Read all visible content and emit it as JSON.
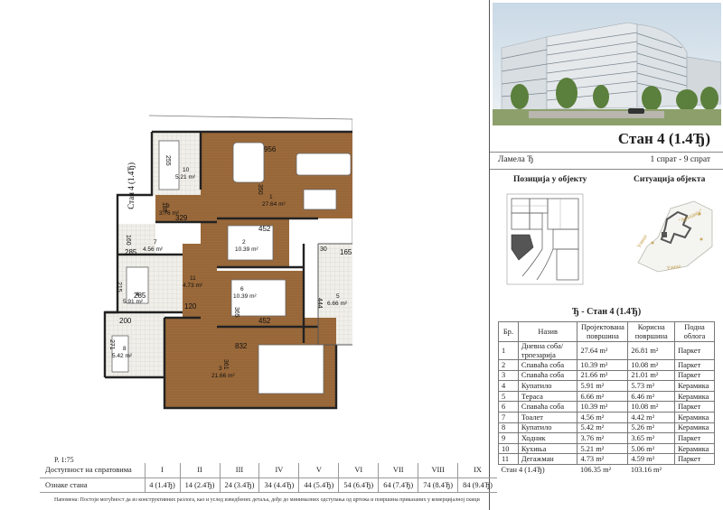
{
  "apartment": {
    "title": "Стан 4 (1.4Ђ)",
    "lamela": "Ламела Ђ",
    "floors_range": "1 спрат - 9 спрат"
  },
  "maps": {
    "position_label": "Позиција у објекту",
    "situation_label": "Ситуација објекта",
    "street_top": "Улица",
    "street_bottom": "Улица",
    "complex_label": "\"Аркадија\""
  },
  "area_table": {
    "title": "Ђ - Стан 4 (1.4Ђ)",
    "headers": {
      "no": "Бр.",
      "name": "Назив",
      "designed": "Пројектована површина",
      "usable": "Корисна површина",
      "floor": "Подна облога"
    },
    "rows": [
      {
        "no": "1",
        "name": "Дневна соба/трпезарија",
        "designed": "27.64 m²",
        "usable": "26.81 m²",
        "floor": "Паркет"
      },
      {
        "no": "2",
        "name": "Спаваћа соба",
        "designed": "10.39 m²",
        "usable": "10.08 m²",
        "floor": "Паркет"
      },
      {
        "no": "3",
        "name": "Спаваћа соба",
        "designed": "21.66 m²",
        "usable": "21.01 m²",
        "floor": "Паркет"
      },
      {
        "no": "4",
        "name": "Купатило",
        "designed": "5.91 m²",
        "usable": "5.73 m²",
        "floor": "Керамика"
      },
      {
        "no": "5",
        "name": "Тераса",
        "designed": "6.66 m²",
        "usable": "6.46 m²",
        "floor": "Керамика"
      },
      {
        "no": "6",
        "name": "Спаваћа соба",
        "designed": "10.39 m²",
        "usable": "10.08 m²",
        "floor": "Паркет"
      },
      {
        "no": "7",
        "name": "Тоалет",
        "designed": "4.56 m²",
        "usable": "4.42 m²",
        "floor": "Керамика"
      },
      {
        "no": "8",
        "name": "Купатило",
        "designed": "5.42 m²",
        "usable": "5.26 m²",
        "floor": "Керамика"
      },
      {
        "no": "9",
        "name": "Ходник",
        "designed": "3.76 m²",
        "usable": "3.65 m²",
        "floor": "Паркет"
      },
      {
        "no": "10",
        "name": "Кухиња",
        "designed": "5.21 m²",
        "usable": "5.06 m²",
        "floor": "Керамика"
      },
      {
        "no": "11",
        "name": "Дегажман",
        "designed": "4.73 m²",
        "usable": "4.59 m²",
        "floor": "Паркет"
      }
    ],
    "total": {
      "label": "Стан 4 (1.4Ђ)",
      "designed": "106.35 m²",
      "usable": "103.16 m²"
    }
  },
  "plan": {
    "scale": "Р. 1:75",
    "apt_label": "Стан 4 (1.4Ђ)",
    "room_labels": [
      {
        "no": "1",
        "area": "27.64 m²"
      },
      {
        "no": "2",
        "area": "10.39 m²"
      },
      {
        "no": "3",
        "area": "21.66 m²"
      },
      {
        "no": "4",
        "area": "5.91 m²"
      },
      {
        "no": "5",
        "area": "6.66 m²"
      },
      {
        "no": "6",
        "area": "10.39 m²"
      },
      {
        "no": "7",
        "area": "4.56 m²"
      },
      {
        "no": "8",
        "area": "5.42 m²"
      },
      {
        "no": "9",
        "area": "3.76 m²"
      },
      {
        "no": "10",
        "area": "5.21 m²"
      },
      {
        "no": "11",
        "area": "4.73 m²"
      }
    ],
    "dimensions": [
      "956",
      "255",
      "350",
      "185",
      "329",
      "452",
      "160",
      "285",
      "30",
      "165",
      "215",
      "285",
      "444",
      "200",
      "120",
      "365",
      "452",
      "271",
      "832",
      "361"
    ]
  },
  "floors_table": {
    "row1_label": "Доступност на спратовима",
    "row2_label": "Ознаке стана",
    "romans": [
      "I",
      "II",
      "III",
      "IV",
      "V",
      "VI",
      "VII",
      "VIII",
      "IX"
    ],
    "codes": [
      "4 (1.4Ђ)",
      "14 (2.4Ђ)",
      "24 (3.4Ђ)",
      "34 (4.4Ђ)",
      "44 (5.4Ђ)",
      "54 (6.4Ђ)",
      "64 (7.4Ђ)",
      "74 (8.4Ђ)",
      "84 (9.4Ђ)"
    ]
  },
  "note": "Напомена: Постоји могућност да из конструктивних разлога, као и услед изведбених детаља, дође до минималних одступања од цртежа и површина приказаних у комерцијалној скици"
}
